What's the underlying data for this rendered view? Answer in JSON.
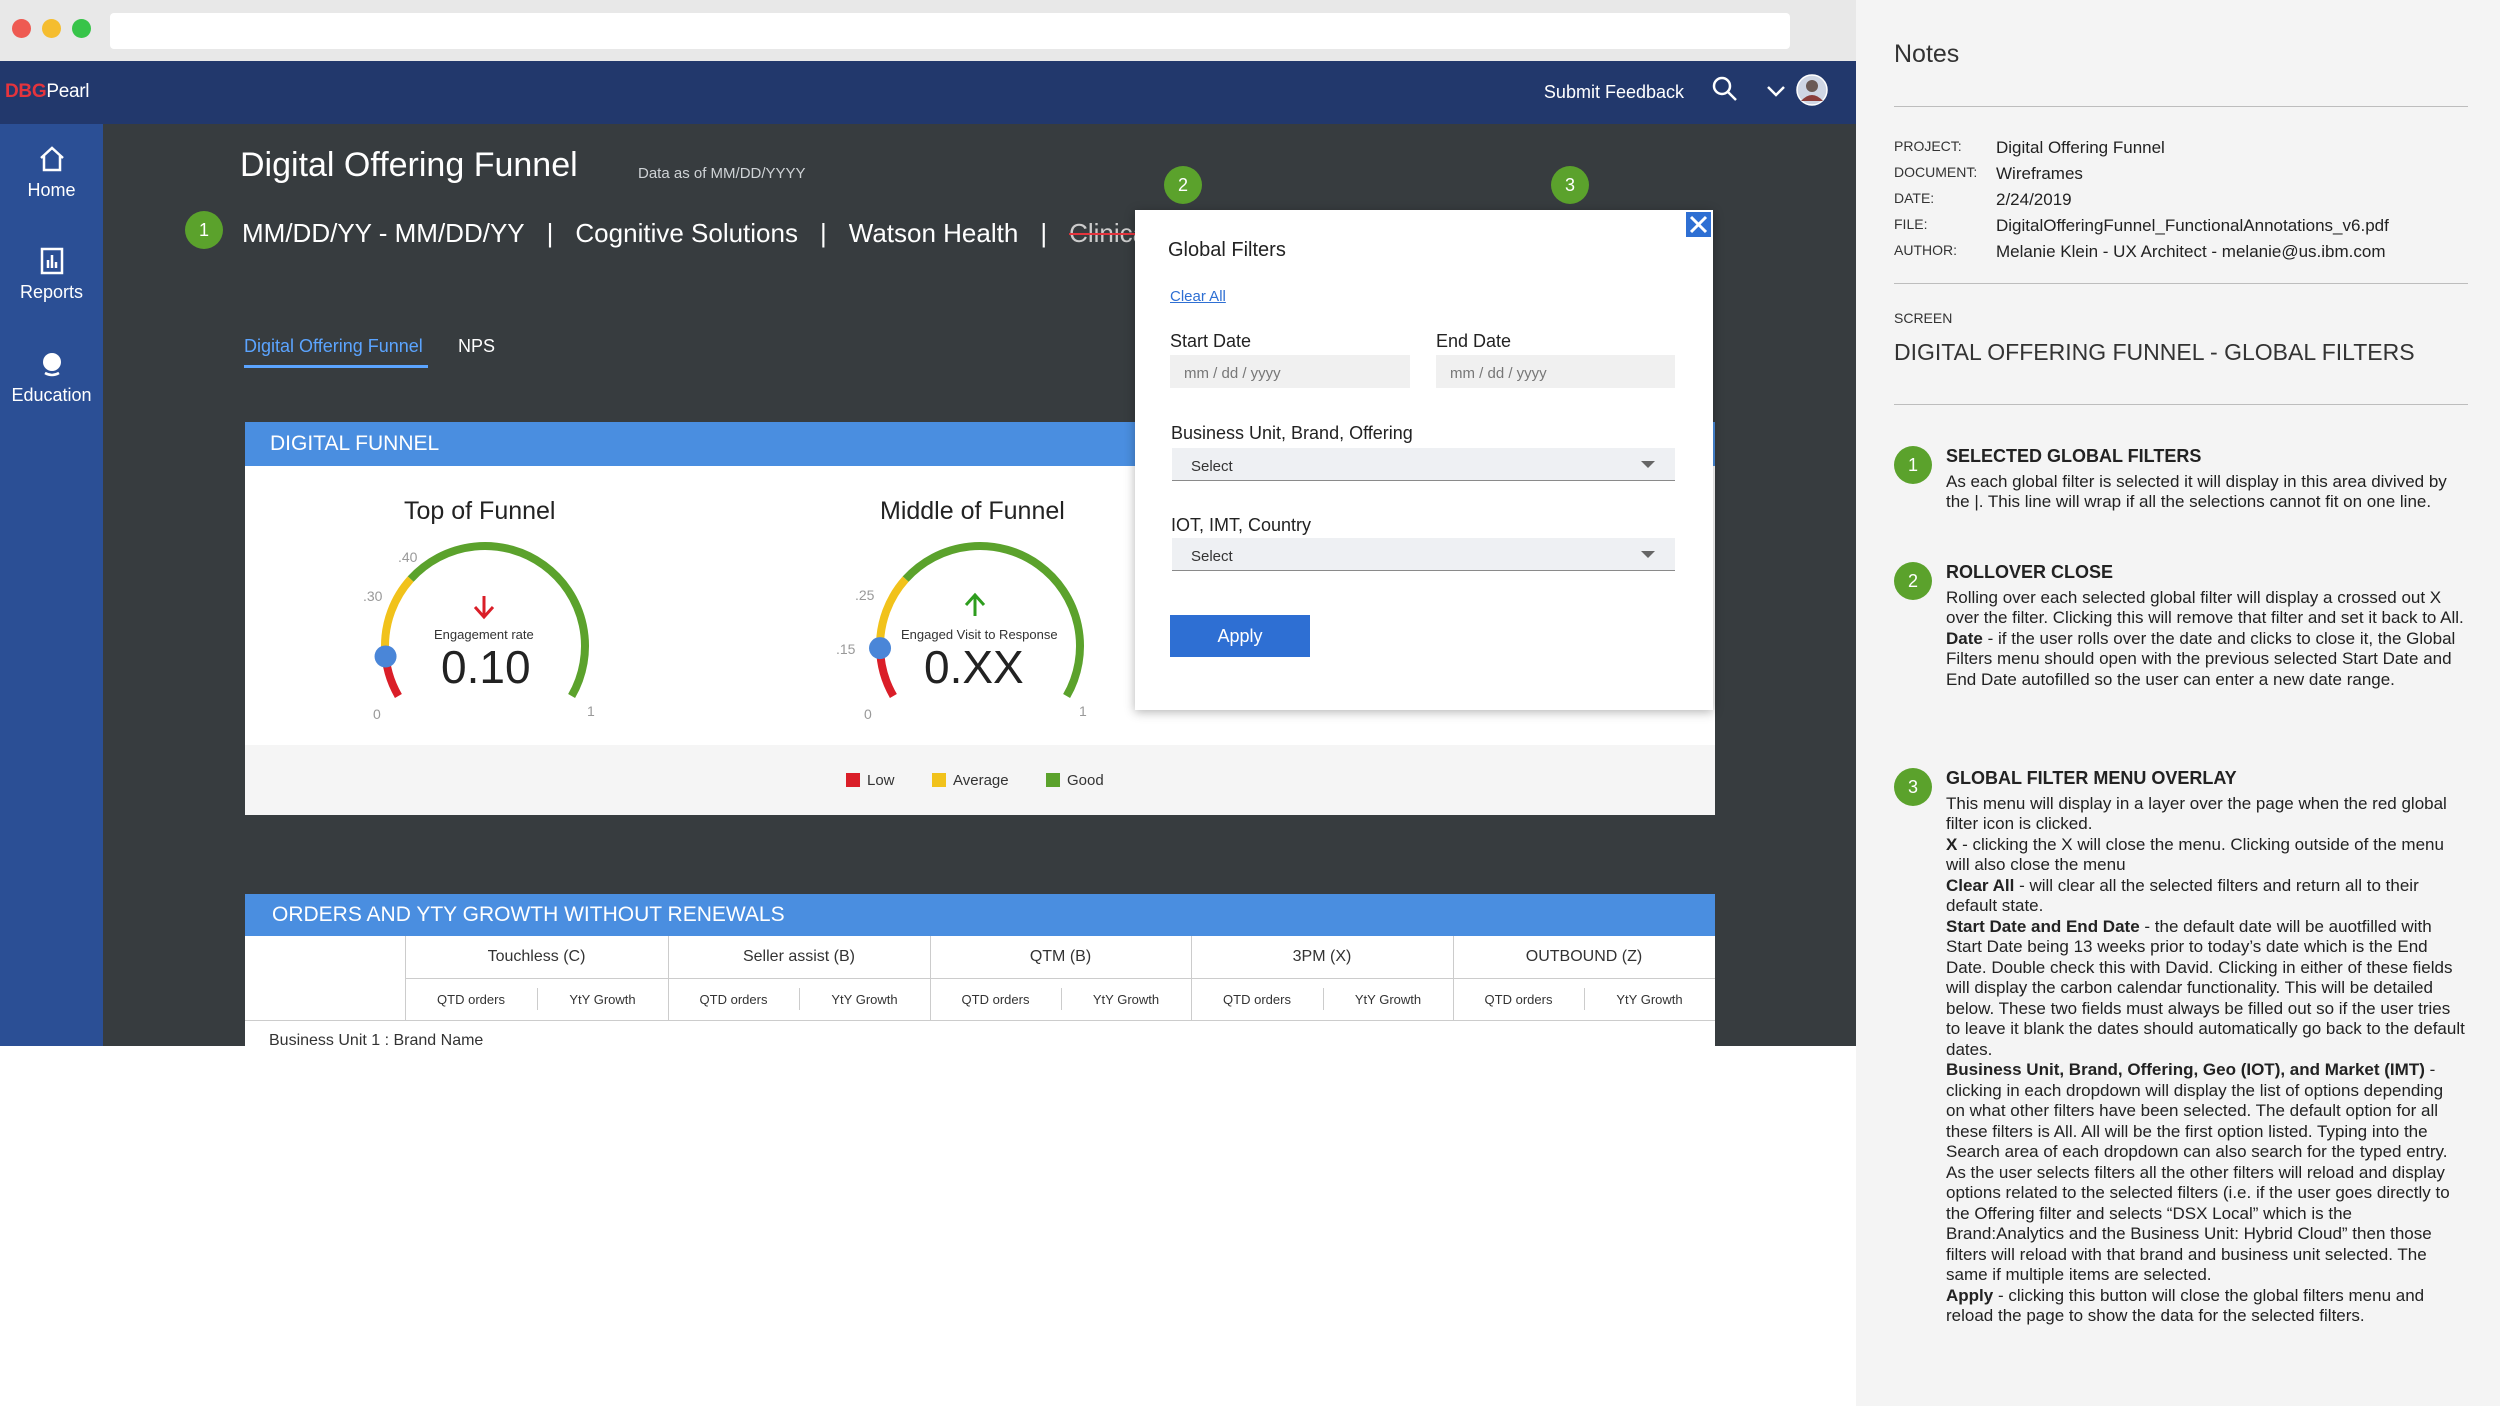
{
  "app": {
    "logo_prefix": "DBG",
    "logo_suffix": "Pearl",
    "submit_feedback": "Submit Feedback"
  },
  "sidebar": {
    "items": [
      {
        "label": "Home"
      },
      {
        "label": "Reports"
      },
      {
        "label": "Education"
      }
    ]
  },
  "page": {
    "title": "Digital Offering Funnel",
    "data_as_of": "Data as of MM/DD/YYYY",
    "filters": {
      "date": "MM/DD/YY - MM/DD/YY",
      "f1": "Cognitive Solutions",
      "f2": "Watson Health",
      "f3": "Clinica",
      "sep": "|"
    },
    "badges": [
      "1",
      "2",
      "3"
    ],
    "tabs": [
      "Digital Offering Funnel",
      "NPS"
    ]
  },
  "funnel": {
    "header": "DIGITAL FUNNEL",
    "gauges": [
      {
        "title": "Top of Funnel",
        "metric": "Engagement rate",
        "value": "0.10",
        "ticks": [
          "0",
          ".30",
          ".40",
          "1"
        ],
        "trend": "down",
        "needle": 0.1
      },
      {
        "title": "Middle of Funnel",
        "metric": "Engaged Visit to Response",
        "value": "0.XX",
        "ticks": [
          "0",
          ".15",
          ".25",
          "1"
        ],
        "trend": "up",
        "needle": 0.12
      }
    ],
    "legend": [
      {
        "label": "Low",
        "color": "#da1e28"
      },
      {
        "label": "Average",
        "color": "#f1c21b"
      },
      {
        "label": "Good",
        "color": "#5ba22c"
      }
    ]
  },
  "orders": {
    "header": "ORDERS AND YTY GROWTH WITHOUT RENEWALS",
    "groups": [
      "Touchless (C)",
      "Seller assist (B)",
      "QTM (B)",
      "3PM (X)",
      "OUTBOUND (Z)"
    ],
    "sub": [
      "QTD orders",
      "YtY Growth"
    ],
    "row1": "Business Unit 1 : Brand Name"
  },
  "modal": {
    "title": "Global Filters",
    "clear_all": "Clear All",
    "start_label": "Start Date",
    "end_label": "End Date",
    "start_placeholder": "mm / dd / yyyy",
    "end_placeholder": "mm / dd / yyyy",
    "bu_label": "Business Unit, Brand, Offering",
    "bu_value": "Select",
    "iot_label": "IOT, IMT, Country",
    "iot_value": "Select",
    "apply": "Apply"
  },
  "notes": {
    "title": "Notes",
    "meta": [
      {
        "k": "PROJECT:",
        "v": "Digital Offering Funnel"
      },
      {
        "k": "DOCUMENT:",
        "v": "Wireframes"
      },
      {
        "k": "DATE:",
        "v": "2/24/2019"
      },
      {
        "k": "FILE:",
        "v": "DigitalOfferingFunnel_FunctionalAnnotations_v6.pdf"
      },
      {
        "k": "AUTHOR:",
        "v": "Melanie Klein - UX Architect - melanie@us.ibm.com"
      }
    ],
    "screen_label": "SCREEN",
    "screen_name": "DIGITAL OFFERING FUNNEL - GLOBAL FILTERS",
    "items": [
      {
        "num": "1",
        "title": "SELECTED GLOBAL FILTERS",
        "lines": [
          {
            "b": "",
            "t": "As each global filter is selected it will display in this area divived by the |.  This line will wrap if all the selections cannot fit on one line."
          }
        ]
      },
      {
        "num": "2",
        "title": "ROLLOVER CLOSE",
        "lines": [
          {
            "b": "",
            "t": "Rolling over each selected global filter will display a crossed out X over the filter. Clicking this will remove that filter and set it back to All."
          },
          {
            "b": "Date",
            "t": " - if the user rolls over the date and clicks to close it, the Global Filters menu should open with the previous selected Start Date and End Date autofilled so the user can enter a new date range."
          }
        ]
      },
      {
        "num": "3",
        "title": "GLOBAL FILTER MENU OVERLAY",
        "lines": [
          {
            "b": "",
            "t": "This menu will display in a layer over the page when the red global filter icon is clicked."
          },
          {
            "b": "X",
            "t": " - clicking the X will close the menu. Clicking outside of the menu will also close the menu"
          },
          {
            "b": "Clear All",
            "t": " - will clear all the selected filters and return all to their default state."
          },
          {
            "b": "Start Date and End Date",
            "t": " - the default date will be auotfilled with Start Date being 13 weeks prior to today’s date which is the End Date. Double check this with David. Clicking in either of these fields will display the carbon calendar functionality. This will be detailed below. These two fields must always be filled out so if the user tries to leave it blank the dates should automatically go back to the default dates."
          },
          {
            "b": "Business Unit, Brand, Offering, Geo (IOT), and Market (IMT)",
            "t": " - clicking in each dropdown will display the list of options depending on what other filters have been selected. The default option for all these filters is All. All will be the first option listed. Typing into the Search area of each dropdown can also search for the typed entry. As the user selects filters all the other filters will reload and display options related to the selected filters (i.e. if the user goes directly to the Offering filter and selects “DSX Local” which is the Brand:Analytics and the Business Unit: Hybrid Cloud” then those filters will reload with that brand and business unit selected. The same if multiple items are selected."
          },
          {
            "b": "Apply",
            "t": " - clicking this button will close the global filters menu and reload the page to show the data for the selected filters."
          }
        ]
      }
    ]
  }
}
